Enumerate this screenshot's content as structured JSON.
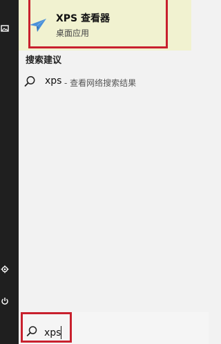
{
  "best_match": {
    "app_name": "XPS 查看器",
    "app_type": "桌面应用"
  },
  "suggestions_section": {
    "title": "搜索建议",
    "items": [
      {
        "term": "xps",
        "description": "- 查看网络搜索结果"
      }
    ]
  },
  "search_box": {
    "value": "xps"
  },
  "colors": {
    "highlight_bg": "#f1f2d0",
    "annotation_red": "#c8202d",
    "rail_bg": "#1f1f1f",
    "panel_bg": "#f2f2f2"
  },
  "icons": {
    "rail_top": "image-icon",
    "rail_settings": "gear-icon",
    "rail_power": "power-icon",
    "app": "xps-viewer-icon",
    "suggestion": "search-icon",
    "search": "search-icon"
  }
}
